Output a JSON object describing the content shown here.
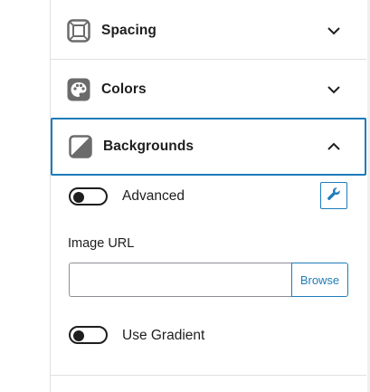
{
  "sections": {
    "spacing": {
      "title": "Spacing",
      "icon": "spacing-icon"
    },
    "colors": {
      "title": "Colors",
      "icon": "palette-icon"
    },
    "backgrounds": {
      "title": "Backgrounds",
      "icon": "background-icon"
    }
  },
  "advanced": {
    "label": "Advanced",
    "enabled": false,
    "icon": "wrench-icon"
  },
  "image_url": {
    "label": "Image URL",
    "value": "",
    "placeholder": "",
    "browse_label": "Browse"
  },
  "gradient": {
    "label": "Use Gradient",
    "enabled": false
  },
  "colors": {
    "accent": "#1e7cba",
    "text": "#1e1e1e",
    "divider": "#e0e0e0"
  }
}
